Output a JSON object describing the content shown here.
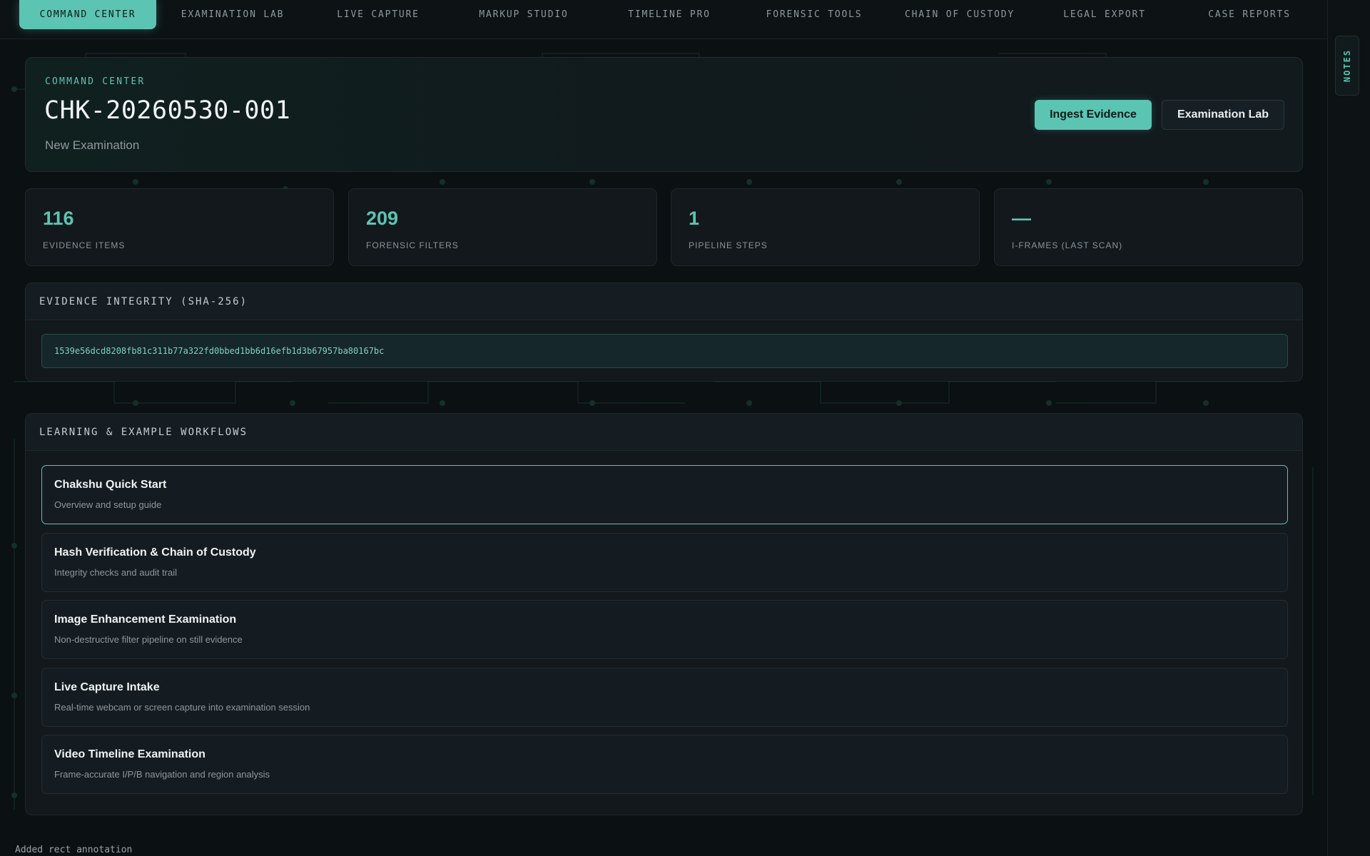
{
  "nav": {
    "tabs": [
      {
        "label": "COMMAND CENTER"
      },
      {
        "label": "EXAMINATION LAB"
      },
      {
        "label": "LIVE CAPTURE"
      },
      {
        "label": "MARKUP STUDIO"
      },
      {
        "label": "TIMELINE PRO"
      },
      {
        "label": "FORENSIC TOOLS"
      },
      {
        "label": "CHAIN OF CUSTODY"
      },
      {
        "label": "LEGAL EXPORT"
      },
      {
        "label": "CASE REPORTS"
      }
    ],
    "active_tab": "COMMAND CENTER"
  },
  "sidebar": {
    "notes_label": "NOTES"
  },
  "hero": {
    "kicker": "COMMAND CENTER",
    "case_id": "CHK-20260530-001",
    "subtitle": "New Examination",
    "primary_button": "Ingest Evidence",
    "secondary_button": "Examination Lab"
  },
  "stats": [
    {
      "value": "116",
      "label": "EVIDENCE ITEMS"
    },
    {
      "value": "209",
      "label": "FORENSIC FILTERS"
    },
    {
      "value": "1",
      "label": "PIPELINE STEPS"
    },
    {
      "value": "—",
      "label": "I-FRAMES (LAST SCAN)"
    }
  ],
  "integrity": {
    "heading": "EVIDENCE INTEGRITY (SHA-256)",
    "hash": "1539e56dcd8208fb81c311b77a322fd0bbed1bb6d16efb1d3b67957ba80167bc"
  },
  "workflows": {
    "heading": "LEARNING & EXAMPLE WORKFLOWS",
    "items": [
      {
        "title": "Chakshu Quick Start",
        "description": "Overview and setup guide"
      },
      {
        "title": "Hash Verification & Chain of Custody",
        "description": "Integrity checks and audit trail"
      },
      {
        "title": "Image Enhancement Examination",
        "description": "Non-destructive filter pipeline on still evidence"
      },
      {
        "title": "Live Capture Intake",
        "description": "Real-time webcam or screen capture into examination session"
      },
      {
        "title": "Video Timeline Examination",
        "description": "Frame-accurate I/P/B navigation and region analysis"
      }
    ],
    "selected_index": 0
  },
  "status_bar": {
    "message": "Added rect annotation"
  },
  "colors": {
    "accent": "#5cc4b2",
    "background": "#0b1013",
    "panel": "#12181c"
  }
}
